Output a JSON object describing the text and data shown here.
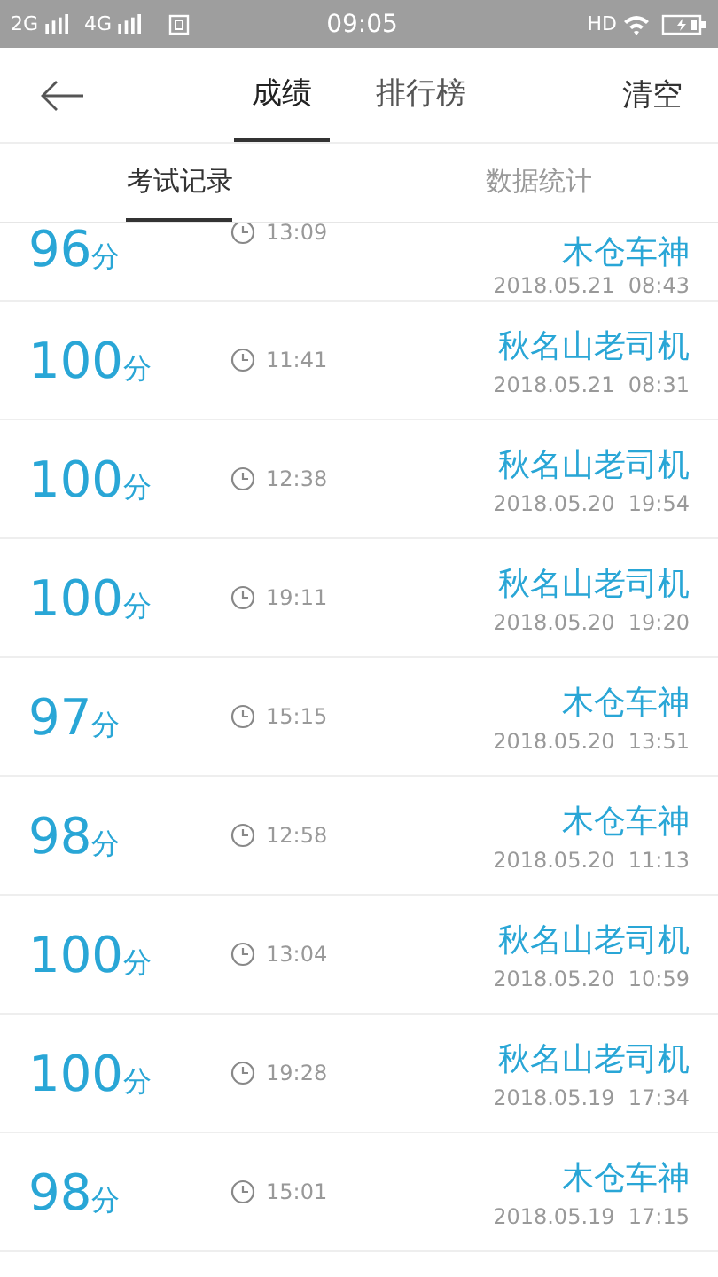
{
  "status_bar": {
    "network_1": "2G",
    "network_2": "4G",
    "time": "09:05",
    "hd": "HD"
  },
  "header": {
    "tabs": [
      {
        "label": "成绩",
        "selected": true
      },
      {
        "label": "排行榜",
        "selected": false
      }
    ],
    "action": "清空"
  },
  "sub_tabs": [
    {
      "label": "考试记录",
      "selected": true
    },
    {
      "label": "数据统计",
      "selected": false
    }
  ],
  "records": [
    {
      "score": "96",
      "unit": "分",
      "duration": "13:09",
      "name": "木仓车神",
      "date": "2018.05.21",
      "time": "08:43"
    },
    {
      "score": "100",
      "unit": "分",
      "duration": "11:41",
      "name": "秋名山老司机",
      "date": "2018.05.21",
      "time": "08:31"
    },
    {
      "score": "100",
      "unit": "分",
      "duration": "12:38",
      "name": "秋名山老司机",
      "date": "2018.05.20",
      "time": "19:54"
    },
    {
      "score": "100",
      "unit": "分",
      "duration": "19:11",
      "name": "秋名山老司机",
      "date": "2018.05.20",
      "time": "19:20"
    },
    {
      "score": "97",
      "unit": "分",
      "duration": "15:15",
      "name": "木仓车神",
      "date": "2018.05.20",
      "time": "13:51"
    },
    {
      "score": "98",
      "unit": "分",
      "duration": "12:58",
      "name": "木仓车神",
      "date": "2018.05.20",
      "time": "11:13"
    },
    {
      "score": "100",
      "unit": "分",
      "duration": "13:04",
      "name": "秋名山老司机",
      "date": "2018.05.20",
      "time": "10:59"
    },
    {
      "score": "100",
      "unit": "分",
      "duration": "19:28",
      "name": "秋名山老司机",
      "date": "2018.05.19",
      "time": "17:34"
    },
    {
      "score": "98",
      "unit": "分",
      "duration": "15:01",
      "name": "木仓车神",
      "date": "2018.05.19",
      "time": "17:15"
    }
  ]
}
